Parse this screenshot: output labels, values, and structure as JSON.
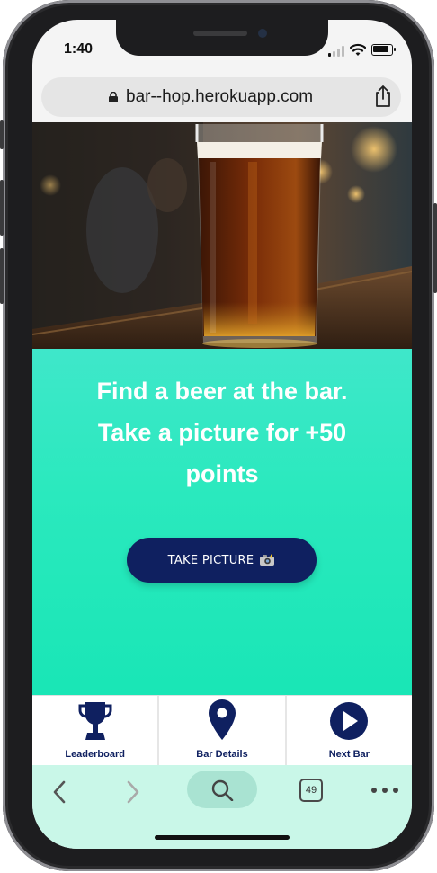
{
  "statusbar": {
    "time": "1:40"
  },
  "browser": {
    "url": "bar--hop.herokuapp.com",
    "tab_count": "49"
  },
  "main": {
    "headline_line1": "Find a beer at the bar.",
    "headline_line2": "Take a picture for +50",
    "headline_line3": "points",
    "take_picture_label": "TAKE PICTURE"
  },
  "tabbar": {
    "items": [
      {
        "label": "Leaderboard",
        "icon": "trophy-icon"
      },
      {
        "label": "Bar Details",
        "icon": "map-pin-icon"
      },
      {
        "label": "Next Bar",
        "icon": "play-circle-icon"
      }
    ]
  },
  "colors": {
    "accent_teal": "#2be9be",
    "navy": "#0f2060",
    "browser_bar": "#c9f7e8"
  }
}
